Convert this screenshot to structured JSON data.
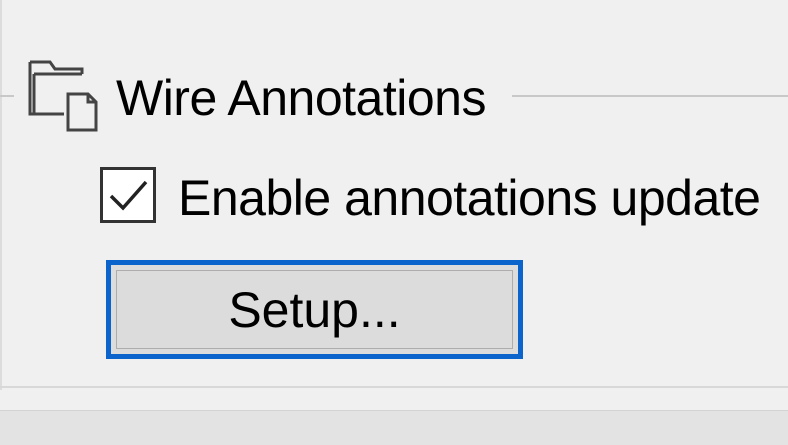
{
  "group": {
    "title": "Wire Annotations",
    "icon": "folder-document-icon"
  },
  "checkbox": {
    "label": "Enable annotations update",
    "checked": true
  },
  "setup_button": {
    "label": "Setup..."
  },
  "colors": {
    "background": "#f0f0f0",
    "focus_border": "#0a64cc",
    "button_face": "#dcdcdc",
    "group_line": "#c8c8c8"
  }
}
